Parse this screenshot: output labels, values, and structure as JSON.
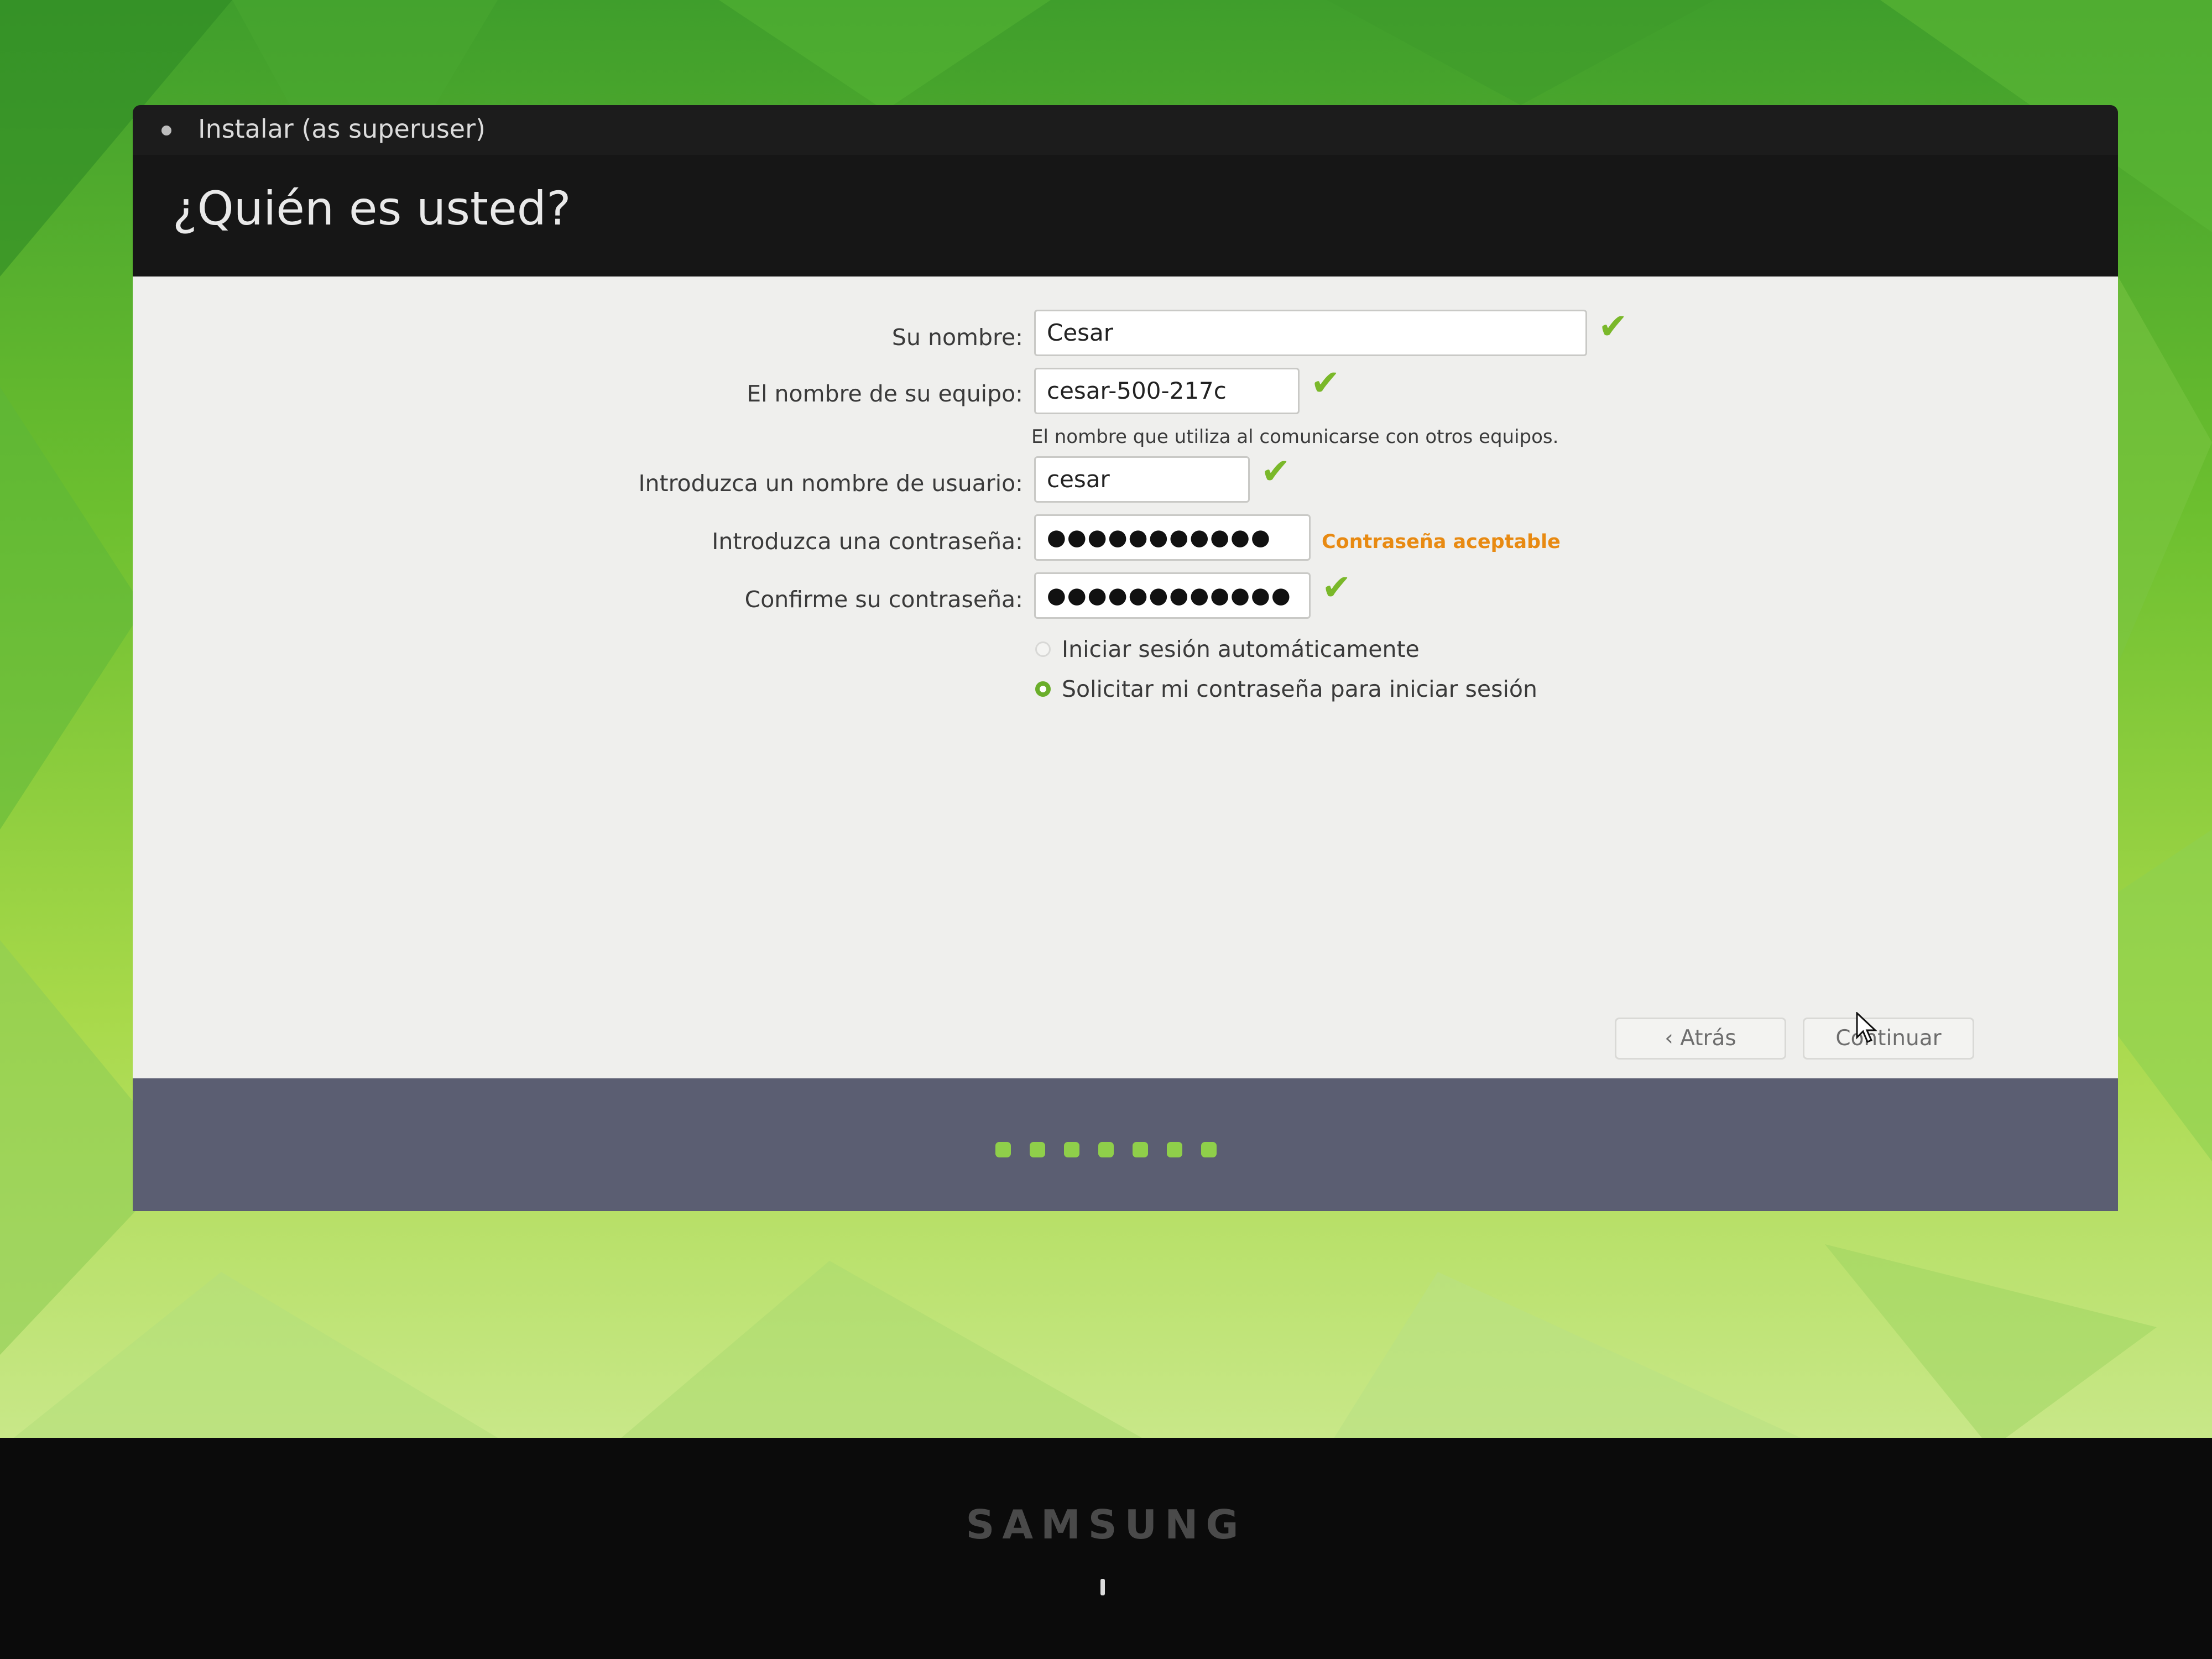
{
  "window": {
    "title": "Instalar (as superuser)",
    "heading": "¿Quién es usted?"
  },
  "form": {
    "name_label": "Su nombre:",
    "name_value": "Cesar",
    "computer_label": "El nombre de su equipo:",
    "computer_value": "cesar-500-217c",
    "computer_hint": "El nombre que utiliza al comunicarse con otros equipos.",
    "username_label": "Introduzca un nombre de usuario:",
    "username_value": "cesar",
    "password_label": "Introduzca una contraseña:",
    "password_value": "●●●●●●●●●●●",
    "password_strength": "Contraseña aceptable",
    "confirm_label": "Confirme su contraseña:",
    "confirm_value": "●●●●●●●●●●●●",
    "check_mark": "✔",
    "login_options": [
      {
        "label": "Iniciar sesión automáticamente",
        "selected": false
      },
      {
        "label": "Solicitar mi contraseña para iniciar sesión",
        "selected": true
      }
    ]
  },
  "buttons": {
    "back_icon": "chevron-left-icon",
    "back_label": "Atrás",
    "continue_label": "Continuar"
  },
  "progress": {
    "steps_total": 7
  },
  "monitor": {
    "brand": "SAMSUNG"
  },
  "colors": {
    "accent_green": "#7ab82a",
    "warning_orange": "#e88a12",
    "footer": "#5b5e72"
  }
}
